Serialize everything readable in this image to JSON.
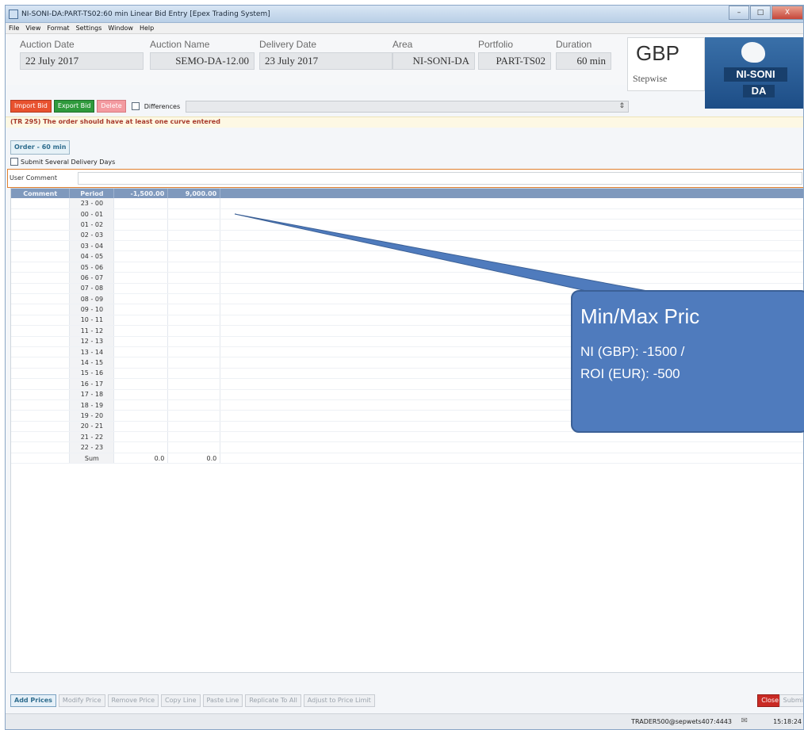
{
  "window": {
    "title": "NI-SONI-DA:PART-TS02:60 min Linear Bid Entry [Epex Trading System]",
    "min_label": "–",
    "max_label": "□",
    "close_label": "X"
  },
  "menu": [
    "File",
    "View",
    "Format",
    "Settings",
    "Window",
    "Help"
  ],
  "header": {
    "auction_date": {
      "label": "Auction Date",
      "value": "22 July 2017"
    },
    "auction_name": {
      "label": "Auction Name",
      "value": "SEMO-DA-12.00"
    },
    "delivery_date": {
      "label": "Delivery Date",
      "value": "23 July 2017"
    },
    "area": {
      "label": "Area",
      "value": "NI-SONI-DA"
    },
    "portfolio": {
      "label": "Portfolio",
      "value": "PART-TS02"
    },
    "duration": {
      "label": "Duration",
      "value": "60 min"
    },
    "currency": "GBP",
    "mode": "Stepwise",
    "logo_top": "NI-SONI",
    "logo_bottom": "DA"
  },
  "actions": {
    "import": "Import Bid",
    "export": "Export Bid",
    "delete": "Delete",
    "differences": "Differences"
  },
  "error": "(TR 295) The order should have at least one curve entered",
  "order_tab": "Order - 60 min",
  "several_days": "Submit Several Delivery Days",
  "user_comment_label": "User Comment",
  "grid": {
    "headers": [
      "Comment",
      "Period",
      "-1,500.00",
      "9,000.00"
    ],
    "periods": [
      "23 - 00",
      "00 - 01",
      "01 - 02",
      "02 - 03",
      "03 - 04",
      "04 - 05",
      "05 - 06",
      "06 - 07",
      "07 - 08",
      "08 - 09",
      "09 - 10",
      "10 - 11",
      "11 - 12",
      "12 - 13",
      "13 - 14",
      "14 - 15",
      "15 - 16",
      "16 - 17",
      "17 - 18",
      "18 - 19",
      "19 - 20",
      "20 - 21",
      "21 - 22",
      "22 - 23"
    ],
    "sum_label": "Sum",
    "sum_values": [
      "0.0",
      "0.0"
    ]
  },
  "callout": {
    "title": "Min/Max Pric",
    "line1": "NI (GBP): -1500 /",
    "line2": "ROI (EUR): -500"
  },
  "bottom_buttons": [
    "Add Prices",
    "Modify Price",
    "Remove Price",
    "Copy Line",
    "Paste Line",
    "Replicate To All",
    "Adjust to Price Limit"
  ],
  "close_button": "Close",
  "submit_button": "Submit",
  "status": {
    "user": "TRADER500@sepwets407:4443",
    "time": "15:18:24"
  }
}
